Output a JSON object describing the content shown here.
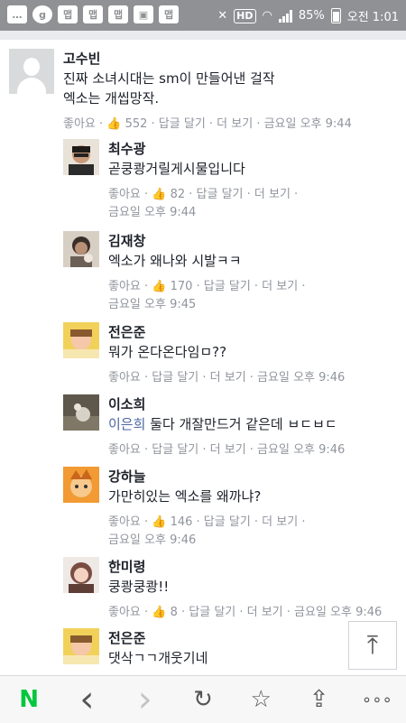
{
  "status_bar": {
    "icons_left": [
      "chat-icon",
      "g-icon",
      "app-icon",
      "app-icon",
      "app-icon",
      "image-icon",
      "app-icon"
    ],
    "left_glyphs": [
      "…",
      "g",
      "맵",
      "맵",
      "맵",
      "▣",
      "맵"
    ],
    "hd": "HD",
    "battery": "85%",
    "time": "오전 1:01"
  },
  "comments": [
    {
      "type": "main",
      "name": "고수빈",
      "lines": [
        "진짜 소녀시대는 sm이 만들어낸 걸작",
        "엑소는 개씹망작."
      ],
      "meta": "좋아요 · 👍 552 · 답글 달기 · 더 보기 · 금요일 오후 9:44",
      "avatar": "default-avatar"
    },
    {
      "type": "reply",
      "name": "최수광",
      "lines": [
        "곧쿵쾅거릴게시물입니다"
      ],
      "meta_lines": [
        "좋아요 · 👍 82 · 답글 달기 · 더 보기 ·",
        "금요일 오후 9:44"
      ],
      "avatar_color": "#3a3430"
    },
    {
      "type": "reply",
      "name": "김재창",
      "lines": [
        "엑소가 왜나와 시발ㅋㅋ"
      ],
      "meta_lines": [
        "좋아요 · 👍 170 · 답글 달기 · 더 보기 ·",
        "금요일 오후 9:45"
      ],
      "avatar_color": "#5c4e44"
    },
    {
      "type": "reply",
      "name": "전은준",
      "lines": [
        "뭐가 온다온다임ㅁ??"
      ],
      "meta_lines": [
        "좋아요 · 답글 달기 · 더 보기 · 금요일 오후 9:46"
      ],
      "avatar_color": "#e9c24a"
    },
    {
      "type": "reply",
      "name": "이소희",
      "mention": "이은희",
      "lines": [
        " 둘다 개잘만드거 같은데 ㅂㄷㅂㄷ"
      ],
      "meta_lines": [
        "좋아요 · 답글 달기 · 더 보기 · 금요일 오후 9:46"
      ],
      "avatar_color": "#6e6a5e"
    },
    {
      "type": "reply",
      "name": "강하늘",
      "lines": [
        "가만히있는 엑소를 왜까냐?"
      ],
      "meta_lines": [
        "좋아요 · 👍 146 · 답글 달기 · 더 보기 ·",
        "금요일 오후 9:46"
      ],
      "avatar_color": "#e98a2c"
    },
    {
      "type": "reply",
      "name": "한미령",
      "lines": [
        "쿵쾅쿵쾅!!"
      ],
      "meta_lines": [
        "좋아요 · 👍 8 · 답글 달기 · 더 보기 · 금요일 오후 9:46"
      ],
      "avatar_color": "#7a4d43"
    },
    {
      "type": "reply",
      "name": "전은준",
      "lines": [
        "댓삭ㄱㄱ개웃기네"
      ],
      "meta_lines": [],
      "avatar_color": "#e9c24a"
    }
  ],
  "scroll_top_glyph": "⤒",
  "bottom_nav": {
    "logo": "N",
    "back": "‹",
    "forward": "›",
    "refresh": "↻",
    "bookmark": "☆",
    "share": "⇪",
    "more": "∘∘∘"
  }
}
